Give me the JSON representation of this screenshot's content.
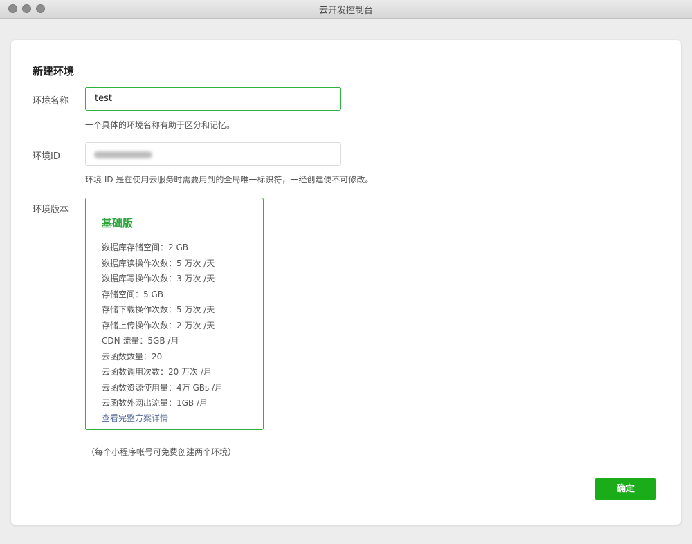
{
  "window": {
    "title": "云开发控制台"
  },
  "form": {
    "heading": "新建环境",
    "name": {
      "label": "环境名称",
      "value": "test",
      "help": "一个具体的环境名称有助于区分和记忆。"
    },
    "env_id": {
      "label": "环境ID",
      "help": "环境 ID 是在使用云服务时需要用到的全局唯一标识符，一经创建便不可修改。"
    },
    "version": {
      "label": "环境版本",
      "plan": {
        "title": "基础版",
        "features": [
          "数据库存储空间：2 GB",
          "数据库读操作次数：5 万次 /天",
          "数据库写操作次数：3 万次 /天",
          "存储空间：5 GB",
          "存储下载操作次数：5 万次 /天",
          "存储上传操作次数：2 万次 /天",
          "CDN 流量：5GB /月",
          "云函数数量：20",
          "云函数调用次数：20 万次 /月",
          "云函数资源使用量：4万 GBs /月",
          "云函数外网出流量：1GB /月"
        ],
        "details_link": "查看完整方案详情"
      }
    },
    "note": "（每个小程序帐号可免费创建两个环境）",
    "confirm_label": "确定"
  },
  "colors": {
    "accent_green": "#1aad19",
    "border_green": "#2eb13e",
    "link_blue": "#576b95"
  }
}
